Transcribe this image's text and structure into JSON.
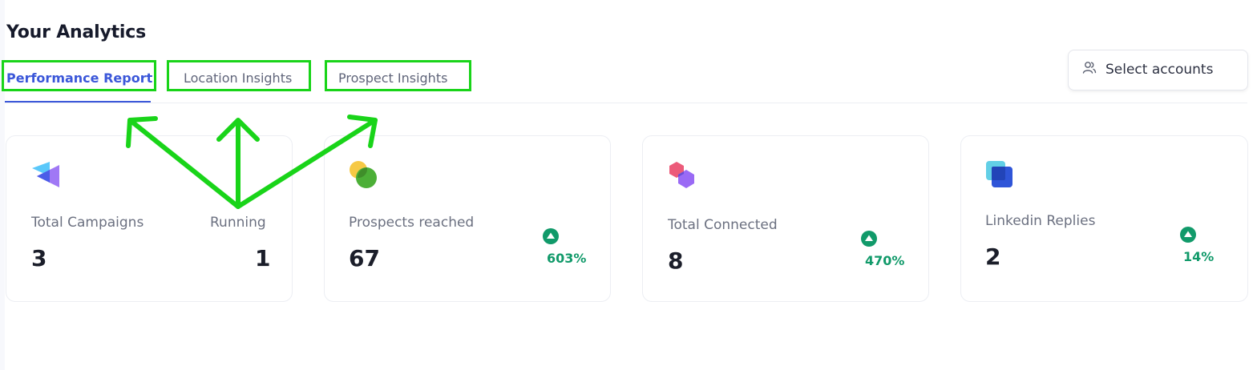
{
  "header": {
    "title": "Your Analytics"
  },
  "tabs": [
    {
      "label": "Performance Report",
      "active": true
    },
    {
      "label": "Location Insights",
      "active": false
    },
    {
      "label": "Prospect Insights",
      "active": false
    }
  ],
  "select_accounts": {
    "label": "Select accounts",
    "icon": "users-icon"
  },
  "cards": [
    {
      "label": "Total Campaigns",
      "value": "3",
      "secondary_label": "Running",
      "secondary_value": "1",
      "icon": "campaigns-icon"
    },
    {
      "label": "Prospects reached",
      "value": "67",
      "trend": "603%",
      "icon": "prospects-icon"
    },
    {
      "label": "Total Connected",
      "value": "8",
      "trend": "470%",
      "icon": "connected-icon"
    },
    {
      "label": "Linkedin Replies",
      "value": "2",
      "trend": "14%",
      "icon": "replies-icon"
    }
  ],
  "colors": {
    "accent": "#3b57d9",
    "trend_up": "#119a6a",
    "annotation": "#19d419"
  }
}
